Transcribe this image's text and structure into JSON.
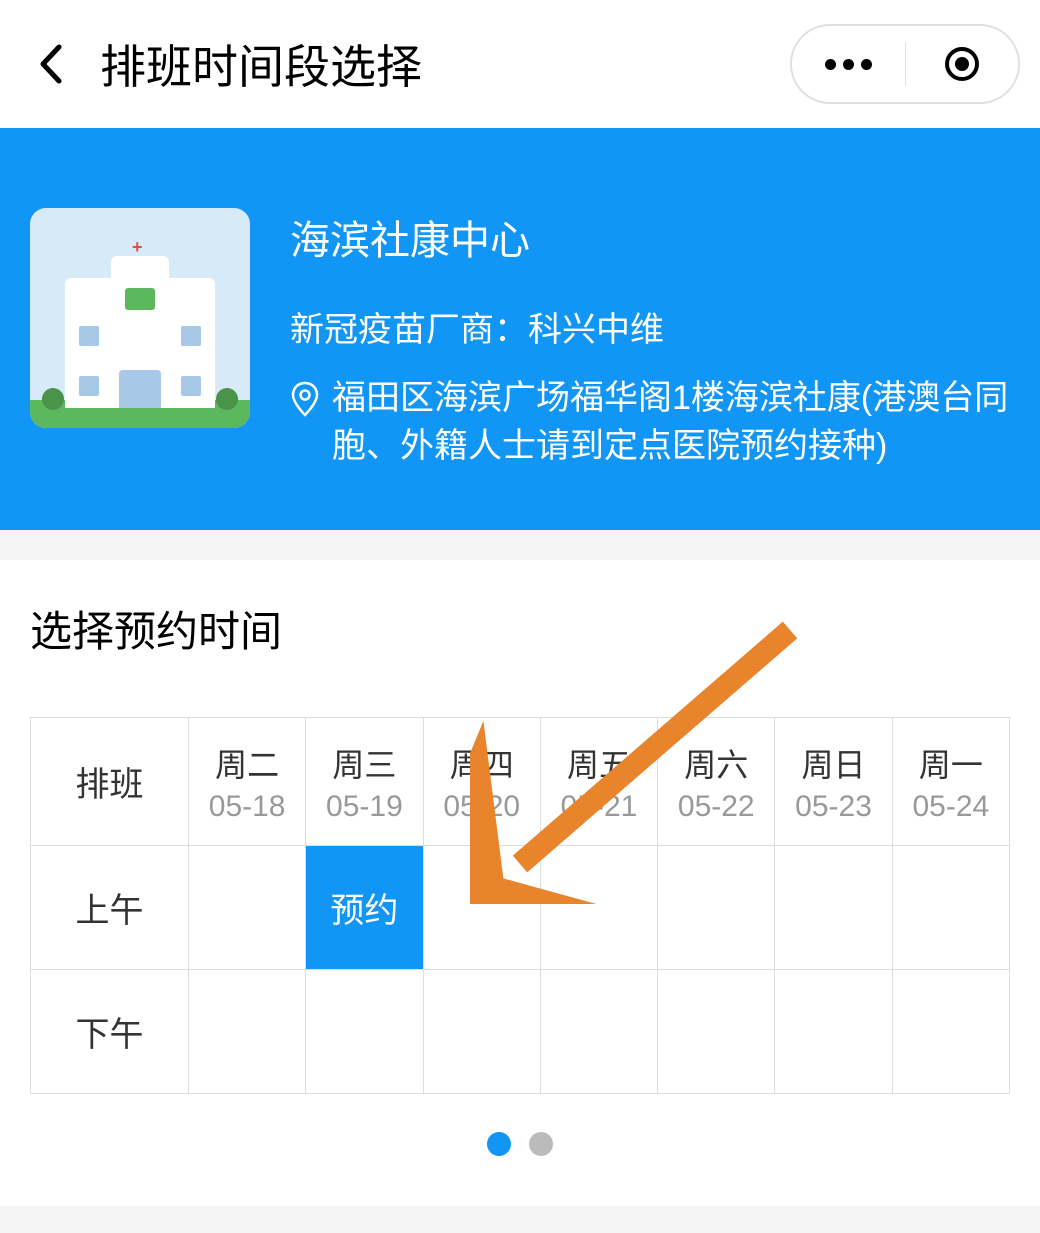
{
  "nav": {
    "title": "排班时间段选择"
  },
  "hospital": {
    "name": "海滨社康中心",
    "vendor": "新冠疫苗厂商：科兴中维",
    "address": "福田区海滨广场福华阁1楼海滨社康(港澳台同胞、外籍人士请到定点医院预约接种)"
  },
  "schedule": {
    "section_title": "选择预约时间",
    "row_header_label": "排班",
    "rows": {
      "morning": "上午",
      "afternoon": "下午"
    },
    "days": [
      {
        "name": "周二",
        "date": "05-18"
      },
      {
        "name": "周三",
        "date": "05-19"
      },
      {
        "name": "周四",
        "date": "05-20"
      },
      {
        "name": "周五",
        "date": "05-21"
      },
      {
        "name": "周六",
        "date": "05-22"
      },
      {
        "name": "周日",
        "date": "05-23"
      },
      {
        "name": "周一",
        "date": "05-24"
      }
    ],
    "slots": {
      "morning": [
        "",
        "预约",
        "",
        "",
        "",
        "",
        ""
      ],
      "afternoon": [
        "",
        "",
        "",
        "",
        "",
        "",
        ""
      ]
    }
  }
}
